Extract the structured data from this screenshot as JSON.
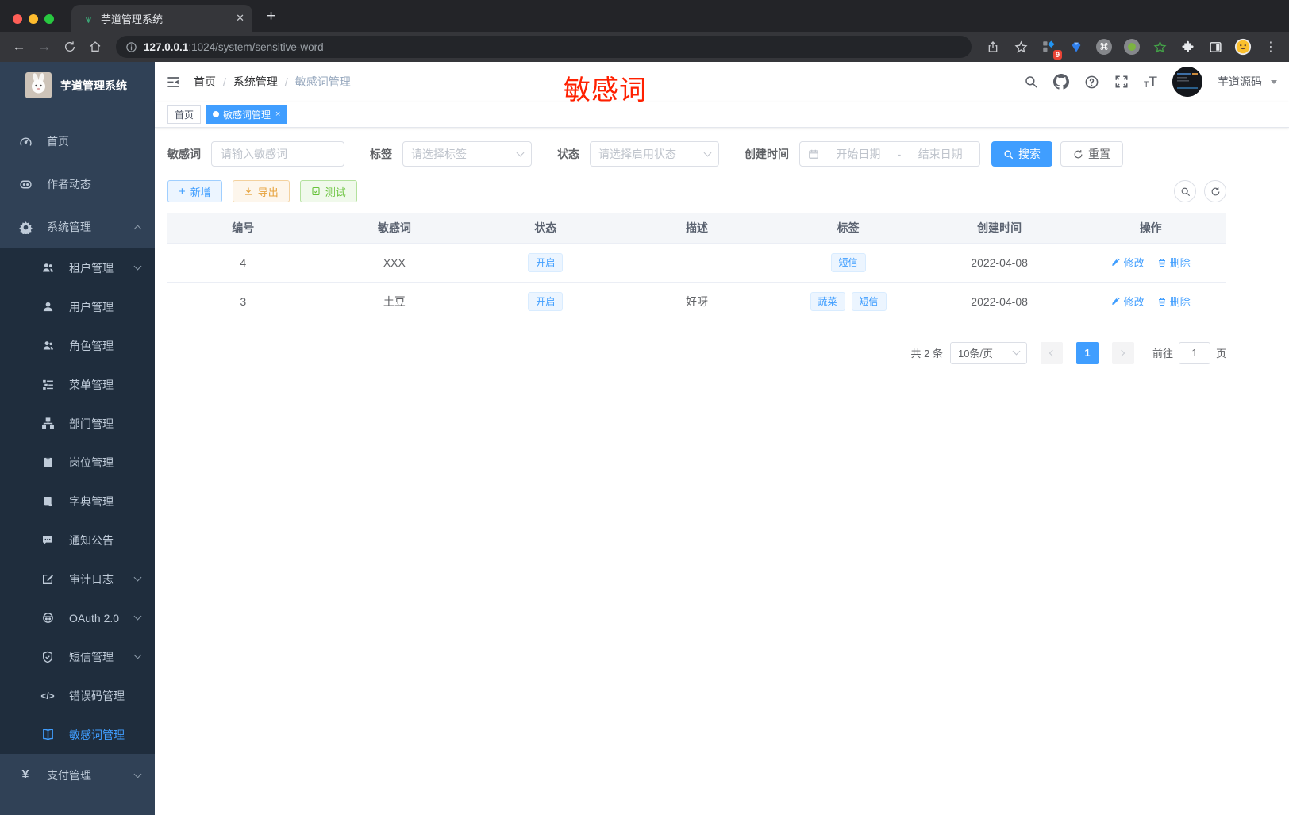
{
  "browser": {
    "tab_title": "芋道管理系统",
    "url_host": "127.0.0.1",
    "url_rest": ":1024/system/sensitive-word",
    "ext_badge": "9"
  },
  "sidebar": {
    "logo_title": "芋道管理系统",
    "items": [
      {
        "label": "首页"
      },
      {
        "label": "作者动态"
      },
      {
        "label": "系统管理"
      },
      {
        "label": "租户管理"
      },
      {
        "label": "用户管理"
      },
      {
        "label": "角色管理"
      },
      {
        "label": "菜单管理"
      },
      {
        "label": "部门管理"
      },
      {
        "label": "岗位管理"
      },
      {
        "label": "字典管理"
      },
      {
        "label": "通知公告"
      },
      {
        "label": "审计日志"
      },
      {
        "label": "OAuth 2.0"
      },
      {
        "label": "短信管理"
      },
      {
        "label": "错误码管理"
      },
      {
        "label": "敏感词管理"
      },
      {
        "label": "支付管理"
      }
    ]
  },
  "header": {
    "breadcrumb_1": "首页",
    "breadcrumb_2": "系统管理",
    "breadcrumb_3": "敏感词管理",
    "sep": "/",
    "annotation": "敏感词",
    "username": "芋道源码"
  },
  "tags_view": {
    "home": "首页",
    "current": "敏感词管理",
    "close": "×"
  },
  "filters": {
    "keyword_label": "敏感词",
    "keyword_placeholder": "请输入敏感词",
    "tag_label": "标签",
    "tag_placeholder": "请选择标签",
    "status_label": "状态",
    "status_placeholder": "请选择启用状态",
    "date_label": "创建时间",
    "date_start_placeholder": "开始日期",
    "date_separator": "-",
    "date_end_placeholder": "结束日期",
    "search_label": "搜索",
    "reset_label": "重置"
  },
  "toolbar": {
    "add_label": "新增",
    "export_label": "导出",
    "test_label": "测试"
  },
  "table": {
    "columns": [
      "编号",
      "敏感词",
      "状态",
      "描述",
      "标签",
      "创建时间",
      "操作"
    ],
    "edit_label": "修改",
    "delete_label": "删除",
    "rows": [
      {
        "id": "4",
        "word": "XXX",
        "status": "开启",
        "description": "",
        "tags": [
          "短信"
        ],
        "created": "2022-04-08"
      },
      {
        "id": "3",
        "word": "土豆",
        "status": "开启",
        "description": "好呀",
        "tags": [
          "蔬菜",
          "短信"
        ],
        "created": "2022-04-08"
      }
    ]
  },
  "pagination": {
    "total_text": "共 2 条",
    "page_size": "10条/页",
    "current_page": "1",
    "goto_label": "前往",
    "goto_value": "1",
    "unit_label": "页"
  },
  "colors": {
    "primary": "#409eff",
    "sidebar_bg": "#304156",
    "submenu_bg": "#1f2d3d",
    "warning": "#e6a23c",
    "success": "#67c23a",
    "annotation_red": "#ff2000"
  }
}
